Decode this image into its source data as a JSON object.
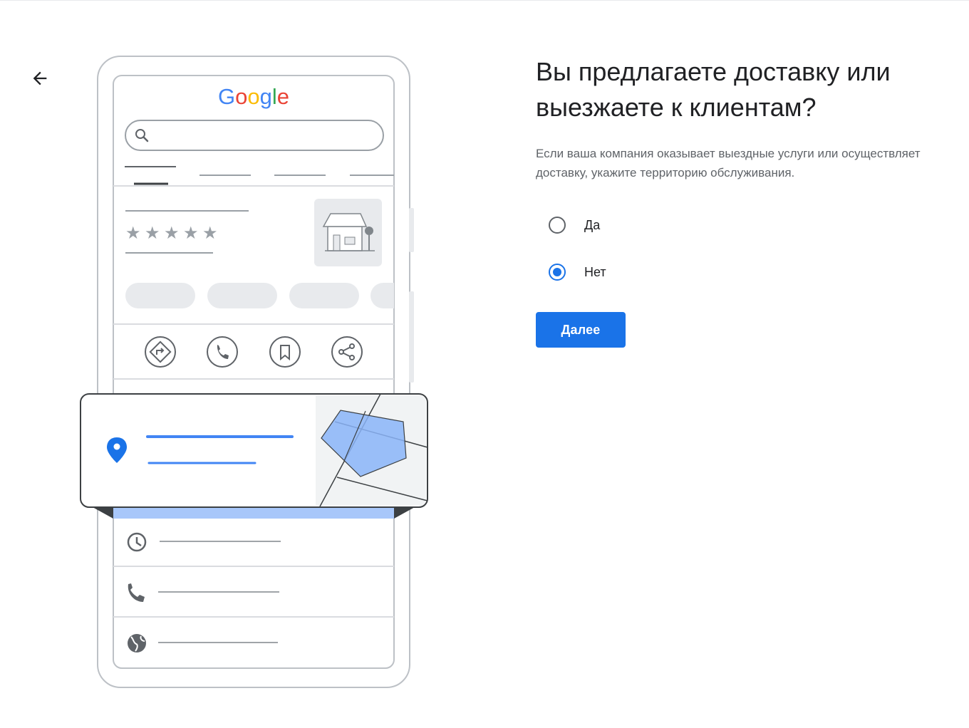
{
  "illustration": {
    "logo_text": "Google",
    "logo_colors": [
      "#4285f4",
      "#ea4335",
      "#fbbc05",
      "#4285f4",
      "#34a853",
      "#ea4335"
    ],
    "rating_stars": 5,
    "action_icons": [
      "directions-icon",
      "phone-icon",
      "bookmark-icon",
      "share-icon"
    ],
    "detail_icons": [
      "clock-icon",
      "phone-icon",
      "globe-icon"
    ]
  },
  "header": {
    "back_icon": "arrow-back-icon"
  },
  "form": {
    "title": "Вы предлагаете доставку или выезжаете к клиентам?",
    "subtitle": "Если ваша компания оказывает выездные услуги или осуществляет доставку, укажите территорию обслуживания.",
    "options": [
      {
        "label": "Да",
        "checked": false
      },
      {
        "label": "Нет",
        "checked": true
      }
    ],
    "next_label": "Далее"
  },
  "colors": {
    "accent": "#1a73e8",
    "text_primary": "#202124",
    "text_secondary": "#5f6368",
    "area_fill": "#8ab4f8"
  }
}
